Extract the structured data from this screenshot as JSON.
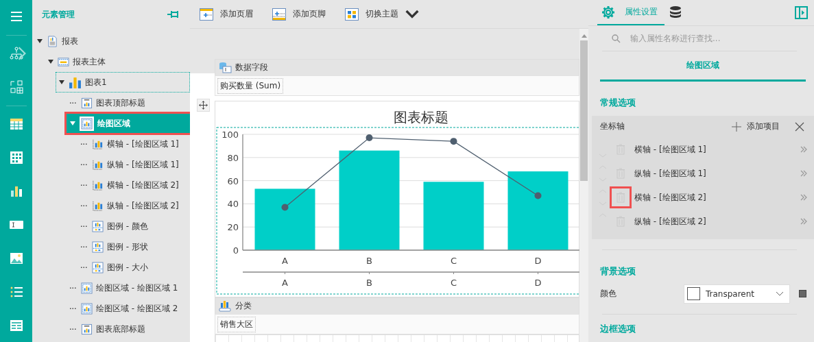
{
  "panel": {
    "title": "元素管理"
  },
  "tree": [
    {
      "label": "报表",
      "kind": "report",
      "expanded": true,
      "selected": false,
      "focused": false,
      "highlighted": false,
      "children": [
        {
          "label": "报表主体",
          "kind": "body",
          "expanded": true,
          "selected": false,
          "focused": false,
          "highlighted": false,
          "children": [
            {
              "label": "图表1",
              "kind": "chart",
              "expanded": true,
              "selected": false,
              "focused": true,
              "highlighted": false,
              "children": [
                {
                  "label": "图表顶部标题",
                  "kind": "title",
                  "selected": false,
                  "focused": false,
                  "highlighted": false
                },
                {
                  "label": "绘图区域",
                  "kind": "plot",
                  "expanded": true,
                  "selected": true,
                  "focused": false,
                  "highlighted": true,
                  "children": [
                    {
                      "label": "横轴 - [绘图区域 1]",
                      "kind": "axis",
                      "selected": false,
                      "focused": false,
                      "highlighted": false
                    },
                    {
                      "label": "纵轴 - [绘图区域 1]",
                      "kind": "axis",
                      "selected": false,
                      "focused": false,
                      "highlighted": false
                    },
                    {
                      "label": "横轴 - [绘图区域 2]",
                      "kind": "axis",
                      "selected": false,
                      "focused": false,
                      "highlighted": false
                    },
                    {
                      "label": "纵轴 - [绘图区域 2]",
                      "kind": "axis",
                      "selected": false,
                      "focused": false,
                      "highlighted": false
                    },
                    {
                      "label": "图例 - 颜色",
                      "kind": "legend",
                      "selected": false,
                      "focused": false,
                      "highlighted": false
                    },
                    {
                      "label": "图例 - 形状",
                      "kind": "legend",
                      "selected": false,
                      "focused": false,
                      "highlighted": false
                    },
                    {
                      "label": "图例 - 大小",
                      "kind": "legend",
                      "selected": false,
                      "focused": false,
                      "highlighted": false
                    }
                  ]
                },
                {
                  "label": "绘图区域 - 绘图区域 1",
                  "kind": "plot",
                  "selected": false,
                  "focused": false,
                  "highlighted": false
                },
                {
                  "label": "绘图区域 - 绘图区域 2",
                  "kind": "plot",
                  "selected": false,
                  "focused": false,
                  "highlighted": false
                },
                {
                  "label": "图表底部标题",
                  "kind": "title",
                  "selected": false,
                  "focused": false,
                  "highlighted": false
                }
              ]
            }
          ]
        }
      ]
    }
  ],
  "toolbar": [
    {
      "label": "添加页眉",
      "kind": "header"
    },
    {
      "label": "添加页脚",
      "kind": "footer"
    },
    {
      "label": "切换主题",
      "kind": "theme"
    }
  ],
  "report": {
    "data_field": {
      "title": "数据字段",
      "items": [
        "购买数量 (Sum)"
      ]
    },
    "chart": {
      "chart_data": {
        "type": "bar",
        "title": "图表标题",
        "categories": [
          "A",
          "B",
          "C",
          "D"
        ],
        "ylim": [
          0,
          100
        ],
        "yticks": [
          0,
          20,
          40,
          60,
          80,
          100
        ],
        "grid": true,
        "series": [
          {
            "color": "#00cfc8",
            "values": [
              53,
              86,
              59,
              68
            ]
          },
          {
            "type": "line",
            "marker": true,
            "color": "#4f5f6f",
            "values": [
              37,
              97,
              94,
              47
            ]
          }
        ]
      },
      "secondary_categories": [
        "A",
        "B",
        "C",
        "D"
      ]
    },
    "category": {
      "title": "分类",
      "items": [
        "销售大区"
      ]
    }
  },
  "properties": {
    "tabs": [
      {
        "kind": "settings",
        "label": "属性设置",
        "selected": true
      },
      {
        "kind": "data",
        "selected": false
      }
    ],
    "search": {
      "placeholder": "输入属性名称进行查找..."
    },
    "heading": "绘图区域",
    "sections": [
      {
        "kind": "collection",
        "title": "常规选项",
        "label": "坐标轴",
        "add_label": "添加项目",
        "items": [
          {
            "label": "横轴 - [绘图区域 1]",
            "highlighted": false
          },
          {
            "label": "纵轴 - [绘图区域 1]",
            "highlighted": false
          },
          {
            "label": "横轴 - [绘图区域 2]",
            "highlighted": true
          },
          {
            "label": "纵轴 - [绘图区域 2]",
            "highlighted": false
          }
        ]
      },
      {
        "kind": "color",
        "title": "背景选项",
        "label": "颜色",
        "value": "Transparent"
      },
      {
        "kind": "header",
        "title": "边框选项"
      }
    ]
  }
}
